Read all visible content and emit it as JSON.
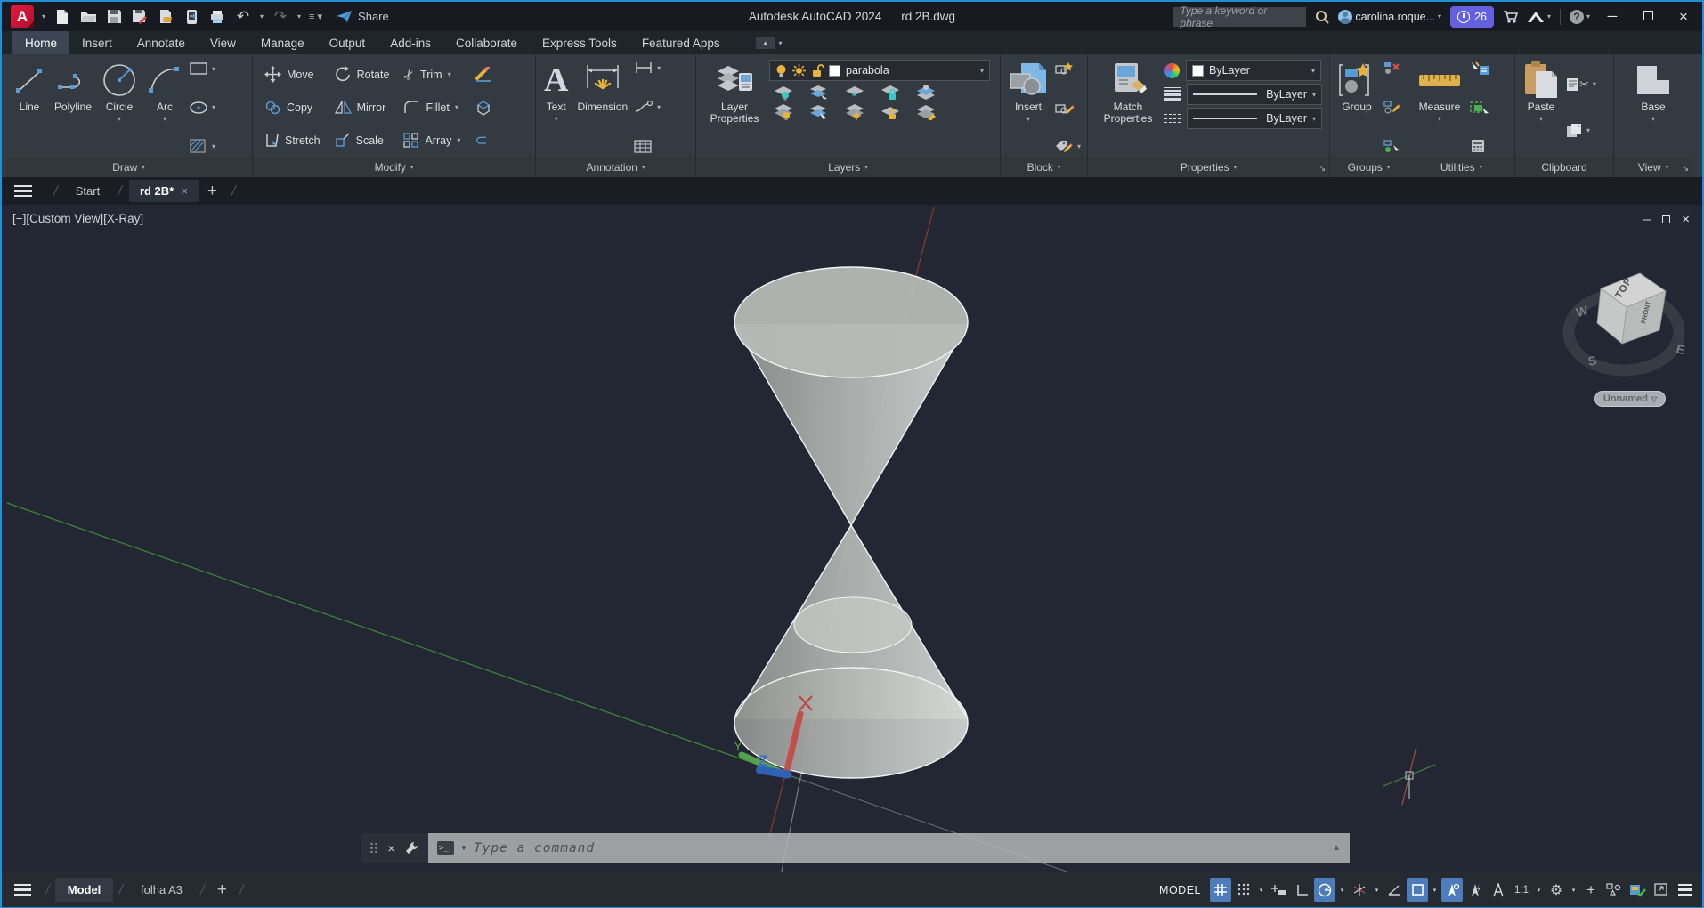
{
  "window": {
    "app_title": "Autodesk AutoCAD 2024",
    "doc_title": "rd 2B.dwg",
    "share_label": "Share",
    "search_placeholder": "Type a keyword or phrase",
    "username": "carolina.roque...",
    "notification_count": "26"
  },
  "ribbon": {
    "tabs": [
      {
        "label": "Home"
      },
      {
        "label": "Insert"
      },
      {
        "label": "Annotate"
      },
      {
        "label": "View"
      },
      {
        "label": "Manage"
      },
      {
        "label": "Output"
      },
      {
        "label": "Add-ins"
      },
      {
        "label": "Collaborate"
      },
      {
        "label": "Express Tools"
      },
      {
        "label": "Featured Apps"
      }
    ],
    "draw": {
      "label": "Draw",
      "line": "Line",
      "polyline": "Polyline",
      "circle": "Circle",
      "arc": "Arc"
    },
    "modify": {
      "label": "Modify",
      "move": "Move",
      "rotate": "Rotate",
      "trim": "Trim",
      "copy": "Copy",
      "mirror": "Mirror",
      "fillet": "Fillet",
      "stretch": "Stretch",
      "scale": "Scale",
      "array": "Array"
    },
    "annotation": {
      "label": "Annotation",
      "text": "Text",
      "dimension": "Dimension"
    },
    "layers": {
      "label": "Layers",
      "layer_properties": "Layer Properties",
      "current_layer": "parabola"
    },
    "block": {
      "label": "Block",
      "insert": "Insert"
    },
    "properties": {
      "label": "Properties",
      "match_properties": "Match Properties",
      "color": "ByLayer",
      "lineweight": "ByLayer",
      "linetype": "ByLayer"
    },
    "groups": {
      "label": "Groups",
      "group": "Group"
    },
    "utilities": {
      "label": "Utilities",
      "measure": "Measure"
    },
    "clipboard": {
      "label": "Clipboard",
      "paste": "Paste"
    },
    "view": {
      "label": "View",
      "base": "Base"
    }
  },
  "file_tabs": {
    "start": "Start",
    "active_doc": "rd 2B*"
  },
  "viewport": {
    "label": "[−][Custom View][X-Ray]",
    "viewcube": {
      "top": "TOP",
      "front": "FRONT",
      "west": "W",
      "south": "S",
      "east": "E"
    },
    "view_name": "Unnamed",
    "ucs": {
      "y": "Y",
      "z": "Z"
    }
  },
  "command_line": {
    "placeholder": "Type a command"
  },
  "status_bar": {
    "model_tab": "Model",
    "layout_tab": "folha A3",
    "model_label": "MODEL",
    "annotation_scale": "1:1"
  },
  "colors": {
    "accent_blue": "#1f8fd6",
    "active_toggle": "#4d7cbb",
    "canvas_bg": "#222733",
    "badge_purple": "#6461e0",
    "layer_yellow": "#e8b33a"
  }
}
